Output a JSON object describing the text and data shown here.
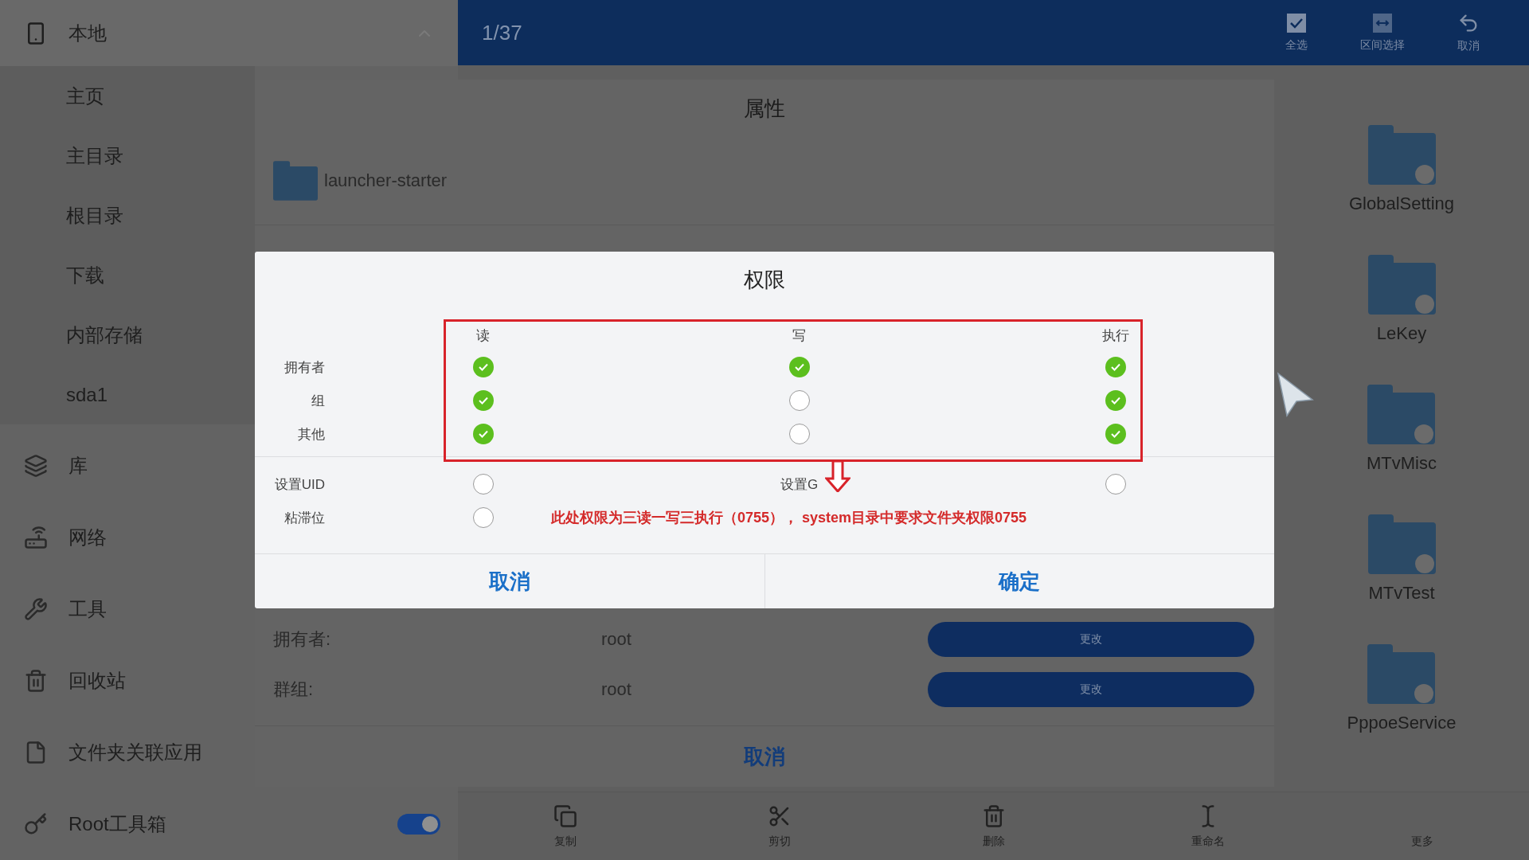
{
  "top_bar": {
    "counter": "1/37",
    "actions": [
      {
        "label": "全选"
      },
      {
        "label": "区间选择"
      },
      {
        "label": "取消"
      }
    ]
  },
  "sidebar": {
    "local": {
      "label": "本地",
      "expanded": true,
      "children": [
        {
          "label": "主页"
        },
        {
          "label": "主目录"
        },
        {
          "label": "根目录"
        },
        {
          "label": "下载"
        },
        {
          "label": "内部存储"
        },
        {
          "label": "sda1"
        }
      ]
    },
    "items": [
      {
        "label": "库",
        "kind": "link"
      },
      {
        "label": "网络",
        "kind": "link"
      },
      {
        "label": "工具",
        "kind": "link"
      },
      {
        "label": "回收站",
        "kind": "link"
      },
      {
        "label": "文件夹关联应用",
        "kind": "link"
      },
      {
        "label": "Root工具箱",
        "kind": "toggle",
        "on": true
      }
    ]
  },
  "properties": {
    "title": "属性",
    "folder_name": "launcher-starter",
    "fields": [
      {
        "label": "拥有者:",
        "value": "root",
        "button": "更改"
      },
      {
        "label": "群组:",
        "value": "root",
        "button": "更改"
      }
    ],
    "cancel": "取消"
  },
  "permissions": {
    "title": "权限",
    "columns": [
      "读",
      "写",
      "执行"
    ],
    "rows": [
      {
        "label": "拥有者",
        "checks": [
          true,
          true,
          true
        ]
      },
      {
        "label": "组",
        "checks": [
          true,
          false,
          true
        ]
      },
      {
        "label": "其他",
        "checks": [
          true,
          false,
          true
        ]
      }
    ],
    "special": [
      {
        "label": "设置UID",
        "checked": false
      },
      {
        "label": "设置G",
        "checked": false
      },
      {
        "label": "粘滞位",
        "checked": false
      }
    ],
    "annotation": "此处权限为三读一写三执行（0755）， system目录中要求文件夹权限0755",
    "buttons": [
      "取消",
      "确定"
    ]
  },
  "folders": [
    {
      "name": "GlobalSetting"
    },
    {
      "name": "LeKey"
    },
    {
      "name": "MTvMisc"
    },
    {
      "name": "MTvTest"
    },
    {
      "name": "PppoeService"
    }
  ],
  "toolbar": [
    {
      "label": "复制"
    },
    {
      "label": "剪切"
    },
    {
      "label": "删除"
    },
    {
      "label": "重命名"
    },
    {
      "label": "更多"
    }
  ]
}
